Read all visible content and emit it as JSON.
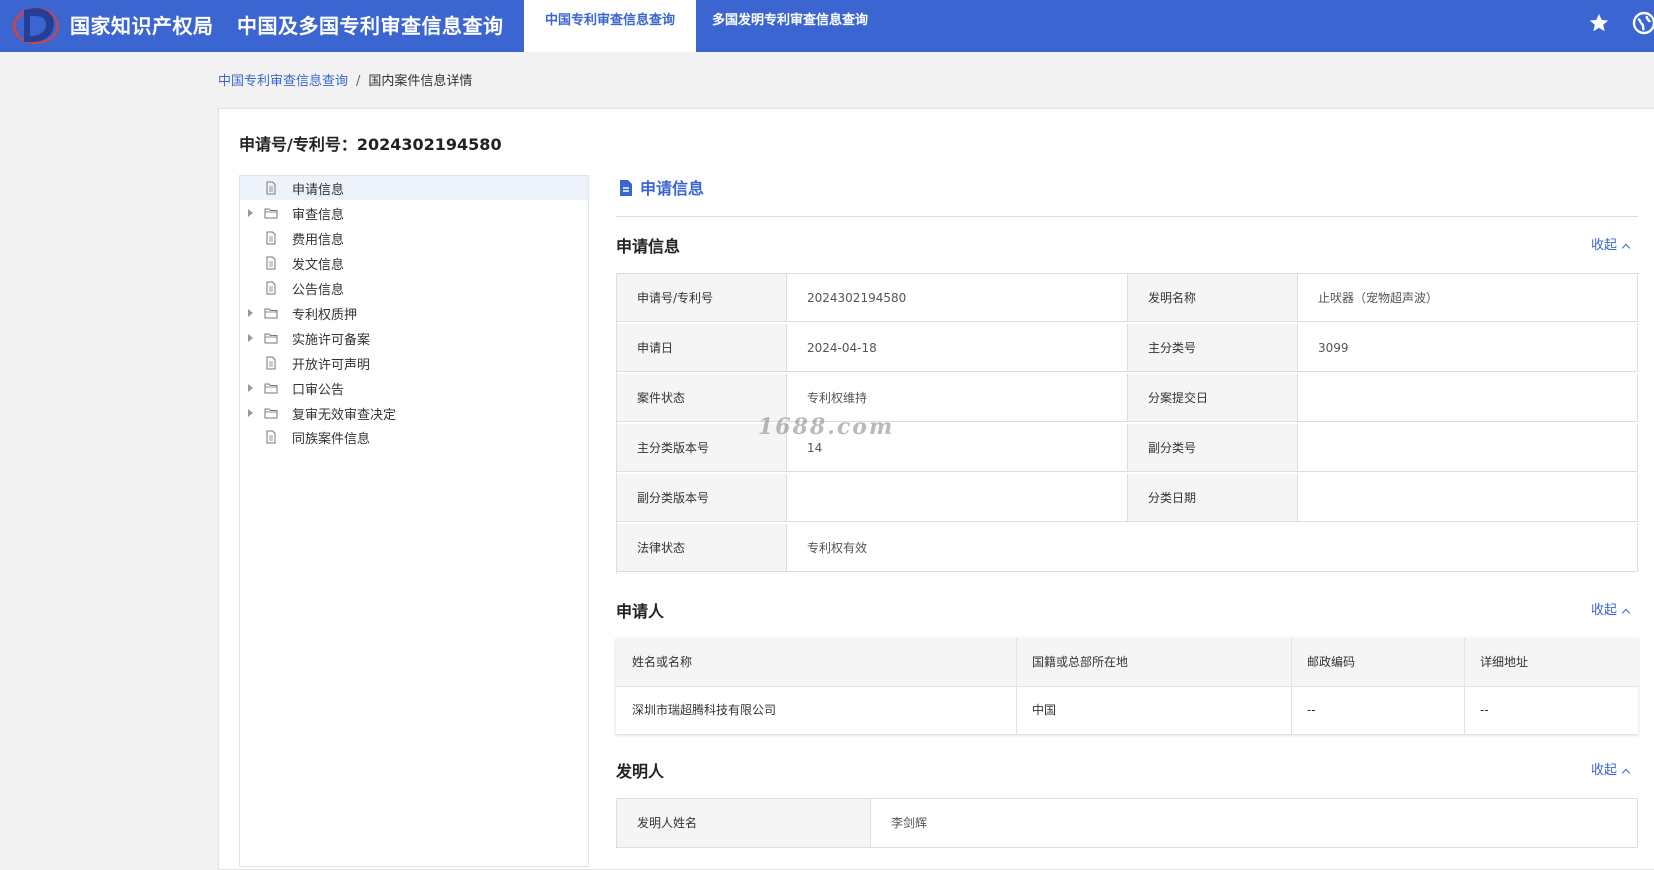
{
  "header": {
    "brand_org": "国家知识产权局",
    "brand_app": "中国及多国专利审查信息查询",
    "tabs": [
      {
        "label": "中国专利审查信息查询"
      },
      {
        "label": "多国发明专利审查信息查询"
      }
    ],
    "icons": {
      "favorite": "star-icon",
      "language": "globe-icon",
      "logo": "cnipa-logo"
    }
  },
  "breadcrumb": {
    "link": "中国专利审查信息查询",
    "sep": "/",
    "current": "国内案件信息详情"
  },
  "patent": {
    "title": "申请号/专利号：2024302194580"
  },
  "tree": {
    "items": [
      {
        "label": "申请信息"
      },
      {
        "label": "审查信息"
      },
      {
        "label": "费用信息"
      },
      {
        "label": "发文信息"
      },
      {
        "label": "公告信息"
      },
      {
        "label": "专利权质押"
      },
      {
        "label": "实施许可备案"
      },
      {
        "label": "开放许可声明"
      },
      {
        "label": "口审公告"
      },
      {
        "label": "复审无效审查决定"
      },
      {
        "label": "同族案件信息"
      }
    ]
  },
  "content": {
    "section_title": "申请信息",
    "collapse_label": "收起",
    "app_info": {
      "title": "申请信息",
      "labels": {
        "app_no": "申请号/专利号",
        "invention_name": "发明名称",
        "app_date": "申请日",
        "main_class": "主分类号",
        "case_status": "案件状态",
        "division_date": "分案提交日",
        "main_class_version": "主分类版本号",
        "sub_class": "副分类号",
        "sub_class_version": "副分类版本号",
        "class_date": "分类日期",
        "legal_status": "法律状态"
      },
      "values": {
        "app_no": "2024302194580",
        "invention_name": "止吠器（宠物超声波）",
        "app_date": "2024-04-18",
        "main_class": "3099",
        "case_status": "专利权维持",
        "division_date": "",
        "main_class_version": "14",
        "sub_class": "",
        "sub_class_version": "",
        "class_date": "",
        "legal_status": "专利权有效"
      }
    },
    "applicant": {
      "title": "申请人",
      "headers": [
        "姓名或名称",
        "国籍或总部所在地",
        "邮政编码",
        "详细地址"
      ],
      "rows": [
        [
          "深圳市瑞超腾科技有限公司",
          "中国",
          "--",
          "--"
        ]
      ]
    },
    "inventor": {
      "title": "发明人",
      "label": "发明人姓名",
      "value": "李剑辉"
    }
  },
  "watermark": "1688.com",
  "colors": {
    "accent": "#3b66d1",
    "background": "#f2f2f2"
  }
}
